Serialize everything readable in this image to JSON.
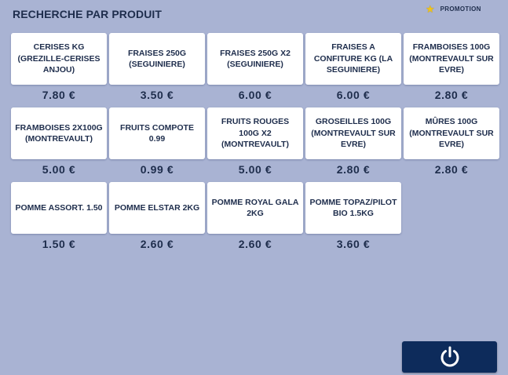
{
  "header": {
    "title": "RECHERCHE PAR PRODUIT",
    "promo_label": "PROMOTION",
    "promo_icon": "star-icon",
    "promo_color": "#f0c419"
  },
  "products": [
    {
      "name": "CERISES KG (GREZILLE-CERISES ANJOU)",
      "price": "7.80 €"
    },
    {
      "name": "FRAISES 250G (SEGUINIERE)",
      "price": "3.50 €"
    },
    {
      "name": "FRAISES 250G X2 (SEGUINIERE)",
      "price": "6.00 €"
    },
    {
      "name": "FRAISES A CONFITURE KG (LA SEGUINIERE)",
      "price": "6.00 €"
    },
    {
      "name": "FRAMBOISES 100G (MONTREVAULT SUR EVRE)",
      "price": "2.80 €"
    },
    {
      "name": "FRAMBOISES 2X100G (MONTREVAULT)",
      "price": "5.00 €"
    },
    {
      "name": "FRUITS COMPOTE 0.99",
      "price": "0.99 €"
    },
    {
      "name": "FRUITS ROUGES 100G X2 (MONTREVAULT)",
      "price": "5.00 €"
    },
    {
      "name": "GROSEILLES 100G (MONTREVAULT SUR EVRE)",
      "price": "2.80 €"
    },
    {
      "name": "MÛRES 100G (MONTREVAULT SUR EVRE)",
      "price": "2.80 €"
    },
    {
      "name": "POMME ASSORT. 1.50",
      "price": "1.50 €"
    },
    {
      "name": "POMME ELSTAR 2KG",
      "price": "2.60 €"
    },
    {
      "name": "POMME ROYAL GALA 2KG",
      "price": "2.60 €"
    },
    {
      "name": "POMME TOPAZ/PILOT BIO 1.5KG",
      "price": "3.60 €"
    }
  ],
  "footer": {
    "power_icon": "power-icon"
  },
  "colors": {
    "background": "#a9b3d3",
    "text": "#1e2d4c",
    "button": "#0d2b5b"
  }
}
